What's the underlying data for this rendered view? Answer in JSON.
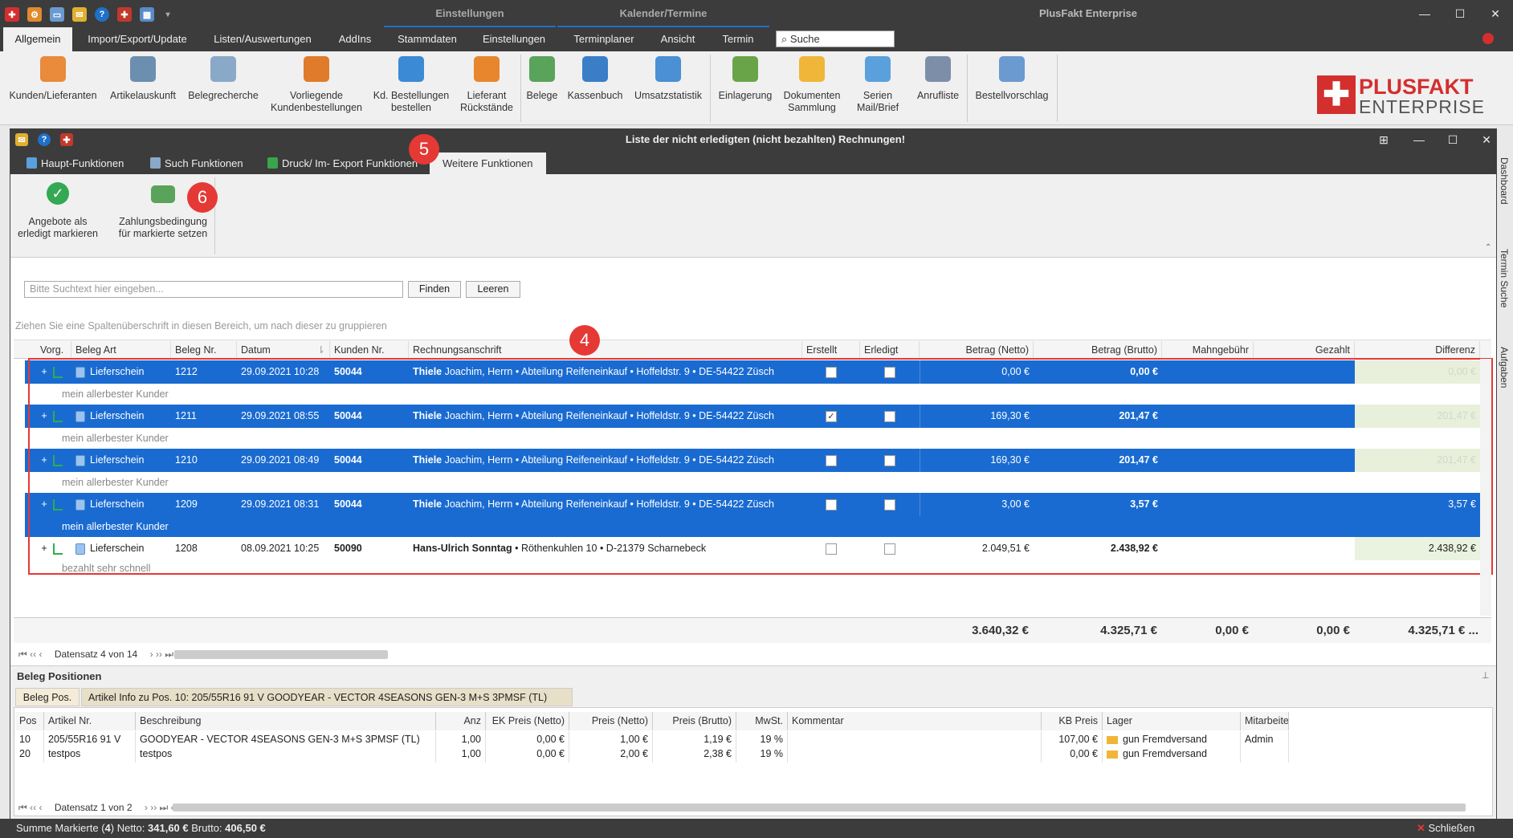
{
  "app": {
    "title": "PlusFakt Enterprise",
    "context_tabs": [
      "Einstellungen",
      "Kalender/Termine"
    ]
  },
  "menu": {
    "items": [
      "Allgemein",
      "Import/Export/Update",
      "Listen/Auswertungen",
      "AddIns",
      "Stammdaten",
      "Einstellungen",
      "Terminplaner",
      "Ansicht",
      "Termin"
    ],
    "search_placeholder": "Suche"
  },
  "ribbon": {
    "buttons": [
      {
        "label": "Kunden/Lieferanten",
        "icon": "customers-icon",
        "color": "#e98b3b"
      },
      {
        "label": "Artikelauskunft",
        "icon": "article-info-icon",
        "color": "#6c8fb0"
      },
      {
        "label": "Belegrecherche",
        "icon": "document-search-icon",
        "color": "#8aa9c8"
      },
      {
        "label": "Vorliegende Kundenbestellungen",
        "icon": "shopping-cart-icon",
        "color": "#e07b2b"
      },
      {
        "label": "Kd. Bestellungen bestellen",
        "icon": "cart-add-icon",
        "color": "#3b8ad6"
      },
      {
        "label": "Lieferant Rückstände",
        "icon": "backlog-icon",
        "color": "#e8862d"
      },
      {
        "label": "Belege",
        "icon": "receipts-icon",
        "color": "#5aa35a"
      },
      {
        "label": "Kassenbuch",
        "icon": "cashbook-icon",
        "color": "#3a7ec8"
      },
      {
        "label": "Umsatzstatistik",
        "icon": "statistics-icon",
        "color": "#4b8fd4"
      },
      {
        "label": "Einlagerung",
        "icon": "storage-icon",
        "color": "#69a548"
      },
      {
        "label": "Dokumenten Sammlung",
        "icon": "folder-icon",
        "color": "#f0b63a"
      },
      {
        "label": "Serien Mail/Brief",
        "icon": "mail-icon",
        "color": "#5aa0dc"
      },
      {
        "label": "Anrufliste",
        "icon": "call-list-icon",
        "color": "#7d8fa8"
      },
      {
        "label": "Bestellvorschlag",
        "icon": "order-suggestion-icon",
        "color": "#6a9ad0"
      }
    ]
  },
  "logo": {
    "line1": "PLUSFAKT",
    "line2": "ENTERPRISE"
  },
  "dialog": {
    "title": "Liste der nicht erledigten (nicht bezahlten) Rechnungen!",
    "tabs": [
      "Haupt-Funktionen",
      "Such Funktionen",
      "Druck/ Im- Export Funktionen",
      "Weitere Funktionen"
    ],
    "actions": [
      {
        "label": "Angebote als erledigt markieren",
        "icon": "check-circle-icon"
      },
      {
        "label": "Zahlungsbedingung für markierte setzen",
        "icon": "payment-terms-icon"
      }
    ],
    "badges": {
      "four": "4",
      "five": "5",
      "six": "6"
    },
    "search": {
      "placeholder": "Bitte Suchtext hier eingeben...",
      "find": "Finden",
      "clear": "Leeren"
    },
    "group_hint": "Ziehen Sie eine Spaltenüberschrift in diesen Bereich, um nach dieser zu gruppieren"
  },
  "grid": {
    "columns": [
      "Vorg.",
      "Beleg Art",
      "Beleg Nr.",
      "Datum",
      "Kunden Nr.",
      "Rechnungsanschrift",
      "Erstellt",
      "Erledigt",
      "Betrag (Netto)",
      "Betrag (Brutto)",
      "Mahngebühr",
      "Gezahlt",
      "Differenz"
    ],
    "rows": [
      {
        "type": "Lieferschein",
        "nr": "1212",
        "date": "29.09.2021 10:28",
        "kunde": "50044",
        "name": "Thiele",
        "addr": " Joachim, Herrn • Abteilung Reifeneinkauf • Hoffeldstr. 9 • DE-54422 Züsch",
        "erstellt": "",
        "erledigt": "",
        "netto": "0,00 €",
        "brutto": "0,00 €",
        "diff": "0,00 €",
        "note": "mein allerbester Kunder",
        "sel": true
      },
      {
        "type": "Lieferschein",
        "nr": "1211",
        "date": "29.09.2021 08:55",
        "kunde": "50044",
        "name": "Thiele",
        "addr": " Joachim, Herrn • Abteilung Reifeneinkauf • Hoffeldstr. 9 • DE-54422 Züsch",
        "erstellt": "✓",
        "erledigt": "",
        "netto": "169,30 €",
        "brutto": "201,47 €",
        "diff": "201,47 €",
        "note": "mein allerbester Kunder",
        "sel": true
      },
      {
        "type": "Lieferschein",
        "nr": "1210",
        "date": "29.09.2021 08:49",
        "kunde": "50044",
        "name": "Thiele",
        "addr": " Joachim, Herrn • Abteilung Reifeneinkauf • Hoffeldstr. 9 • DE-54422 Züsch",
        "erstellt": "",
        "erledigt": "",
        "netto": "169,30 €",
        "brutto": "201,47 €",
        "diff": "201,47 €",
        "note": "mein allerbester Kunder",
        "sel": true
      },
      {
        "type": "Lieferschein",
        "nr": "1209",
        "date": "29.09.2021 08:31",
        "kunde": "50044",
        "name": "Thiele",
        "addr": " Joachim, Herrn • Abteilung Reifeneinkauf • Hoffeldstr. 9 • DE-54422 Züsch",
        "erstellt": "",
        "erledigt": "",
        "netto": "3,00 €",
        "brutto": "3,57 €",
        "diff": "3,57 €",
        "note": "mein allerbester Kunder",
        "sel": true
      },
      {
        "type": "Lieferschein",
        "nr": "1208",
        "date": "08.09.2021 10:25",
        "kunde": "50090",
        "name": "Hans-Ulrich Sonntag",
        "addr": " • Röthenkuhlen 10 • D-21379 Scharnebeck",
        "erstellt": "",
        "erledigt": "",
        "netto": "2.049,51 €",
        "brutto": "2.438,92 €",
        "diff": "2.438,92 €",
        "note": "bezahlt sehr schnell",
        "sel": false
      }
    ],
    "totals": {
      "netto": "3.640,32 €",
      "brutto": "4.325,71 €",
      "mahn": "0,00 €",
      "gezahlt": "0,00 €",
      "diff": "4.325,71 € ..."
    },
    "nav": "Datensatz 4 von 14"
  },
  "positions": {
    "title": "Beleg Positionen",
    "tabs": [
      "Beleg Pos.",
      "Artikel Info zu Pos. 10: 205/55R16 91 V GOODYEAR - VECTOR 4SEASONS GEN-3 M+S 3PMSF (TL)"
    ],
    "columns": [
      "Pos",
      "Artikel Nr.",
      "Beschreibung",
      "Anz",
      "EK Preis (Netto)",
      "Preis (Netto)",
      "Preis (Brutto)",
      "MwSt.",
      "Kommentar",
      "KB Preis",
      "Lager",
      "Mitarbeite"
    ],
    "rows": [
      {
        "pos": "10",
        "art": "205/55R16 91 V",
        "desc": "GOODYEAR - VECTOR 4SEASONS GEN-3 M+S 3PMSF (TL)",
        "anz": "1,00",
        "ek": "0,00 €",
        "netto": "1,00 €",
        "brutto": "1,19 €",
        "mwst": "19 %",
        "komm": "",
        "kb": "107,00 €",
        "lager": "gun Fremdversand",
        "ma": "Admin"
      },
      {
        "pos": "20",
        "art": "testpos",
        "desc": "testpos",
        "anz": "1,00",
        "ek": "0,00 €",
        "netto": "2,00 €",
        "brutto": "2,38 €",
        "mwst": "19 %",
        "komm": "",
        "kb": "0,00 €",
        "lager": "gun Fremdversand",
        "ma": ""
      }
    ],
    "nav": "Datensatz 1 von 2"
  },
  "side_tabs": [
    "Dashboard",
    "Termin Suche",
    "Aufgaben"
  ],
  "status": {
    "prefix": "Summe Markierte (",
    "count": "4",
    "mid": ") Netto: ",
    "netto": "341,60 €",
    "brutto_label": " Brutto: ",
    "brutto": "406,50 €",
    "close": "Schließen"
  }
}
